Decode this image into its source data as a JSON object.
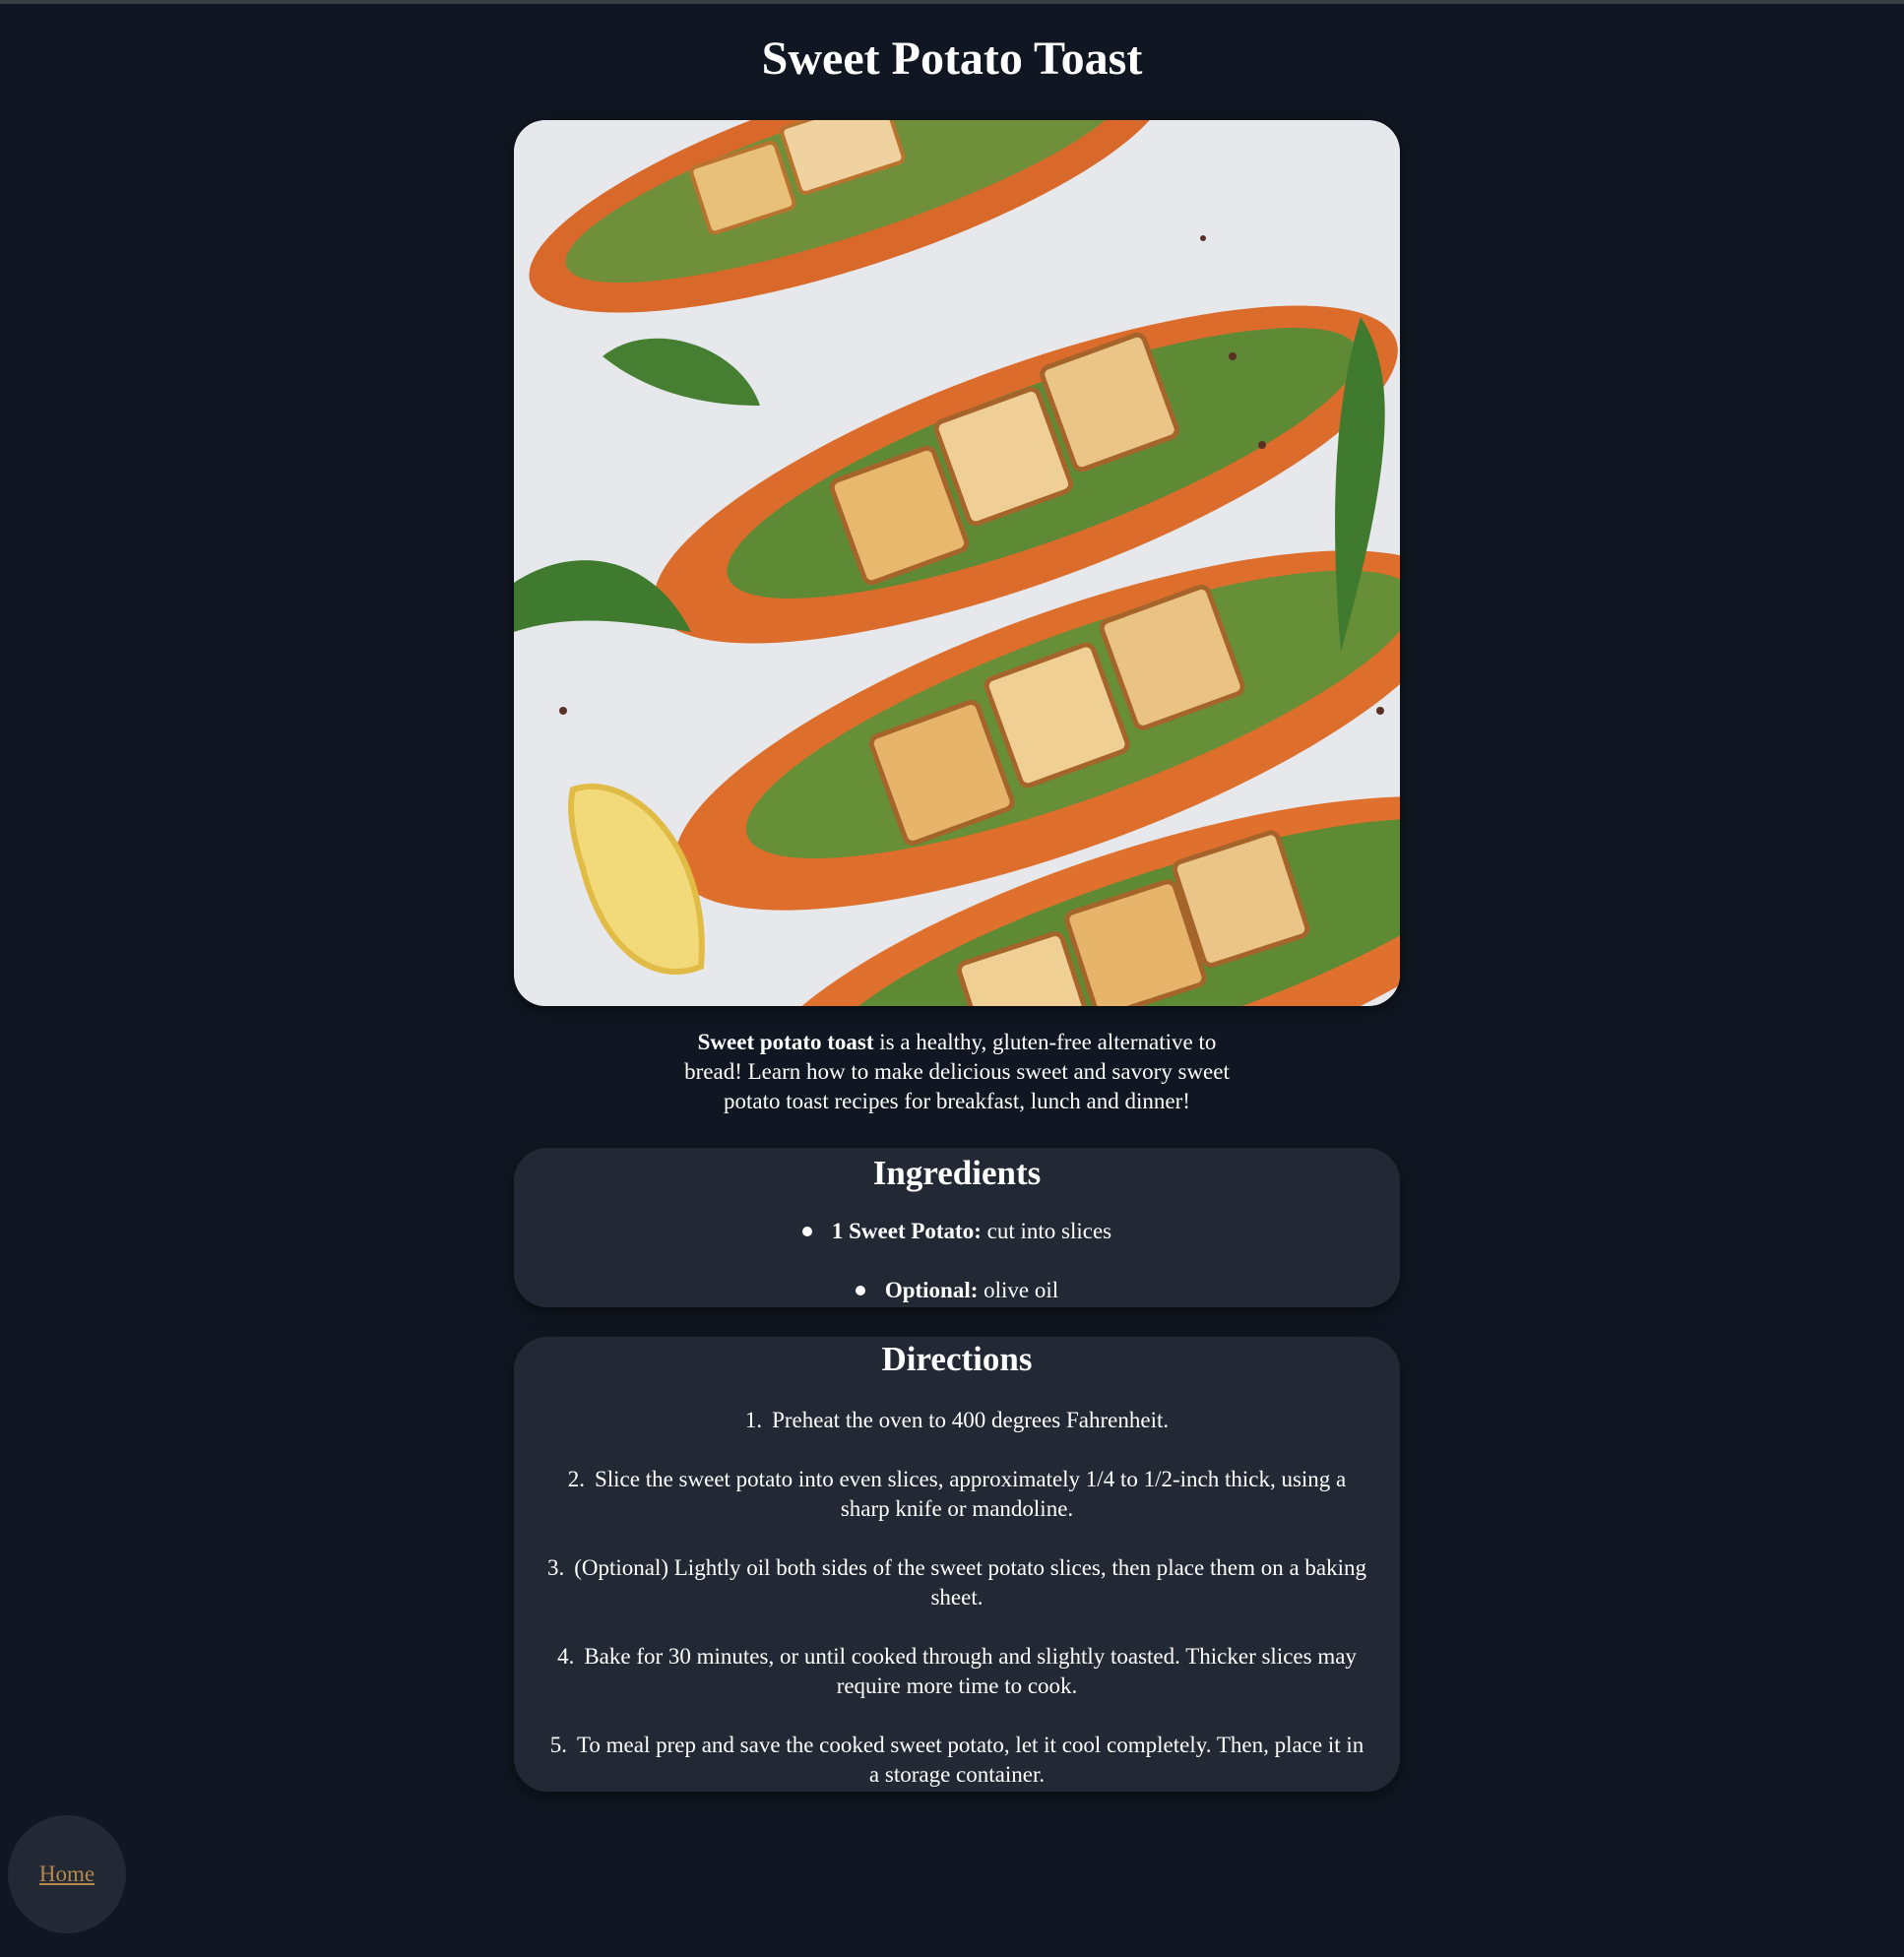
{
  "page": {
    "title": "Sweet Potato Toast"
  },
  "hero": {
    "image_icon": "sweet-potato-toast-photo"
  },
  "intro": {
    "bold": "Sweet potato toast",
    "rest": " is a healthy, gluten-free alternative to bread! Learn how to make delicious sweet and savory sweet potato toast recipes for breakfast, lunch and dinner!"
  },
  "ingredients": {
    "heading": "Ingredients",
    "items": [
      {
        "bold": "1 Sweet Potato:",
        "text": " cut into slices"
      },
      {
        "bold": "Optional:",
        "text": " olive oil"
      }
    ]
  },
  "directions": {
    "heading": "Directions",
    "steps": [
      {
        "num": "1.",
        "line1": "Preheat the oven to 400 degrees Fahrenheit.",
        "line2": ""
      },
      {
        "num": "2.",
        "line1": "Slice the sweet potato into even slices, approximately 1/4 to 1/2-inch thick, using a",
        "line2": "sharp knife or mandoline."
      },
      {
        "num": "3.",
        "line1": "(Optional) Lightly oil both sides of the sweet potato slices, then place them on a baking",
        "line2": "sheet."
      },
      {
        "num": "4.",
        "line1": "Bake for 30 minutes, or until cooked through and slightly toasted. Thicker slices may",
        "line2": "require more time to cook."
      },
      {
        "num": "5.",
        "line1": "To meal prep and save the cooked sweet potato, let it cool completely. Then, place it in",
        "line2": "a storage container."
      }
    ]
  },
  "nav": {
    "home_label": "Home"
  },
  "colors": {
    "background": "#111722",
    "card": "#222834",
    "link": "#b5894d",
    "text": "#ffffff"
  }
}
